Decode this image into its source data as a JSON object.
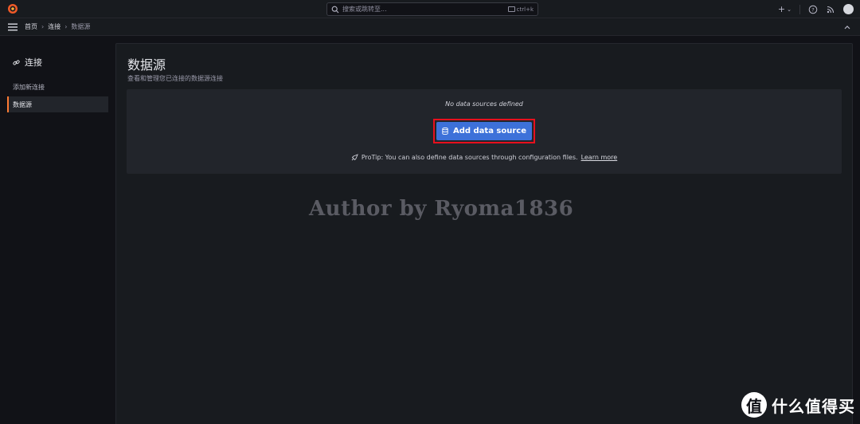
{
  "topbar": {
    "search_placeholder": "搜索或跳转至...",
    "search_shortcut": "ctrl+k",
    "new_button_label": "+"
  },
  "breadcrumb": [
    "首页",
    "连接",
    "数据源"
  ],
  "sidenav": {
    "title": "连接",
    "items": [
      {
        "label": "添加新连接",
        "active": false
      },
      {
        "label": "数据源",
        "active": true
      }
    ]
  },
  "main": {
    "title": "数据源",
    "subtitle": "查看和管理您已连接的数据源连接",
    "empty_message": "No data sources defined",
    "add_button_label": "Add data source",
    "protip_text": "ProTip: You can also define data sources through configuration files.",
    "learn_more": "Learn more"
  },
  "watermark": "Author by Ryoma1836",
  "corner_logo": {
    "glyph": "值",
    "text": "什么值得买"
  },
  "colors": {
    "accent": "#3d71d9",
    "highlight": "#e8101d",
    "active_indicator": "#ff7a33",
    "background": "#111217"
  }
}
